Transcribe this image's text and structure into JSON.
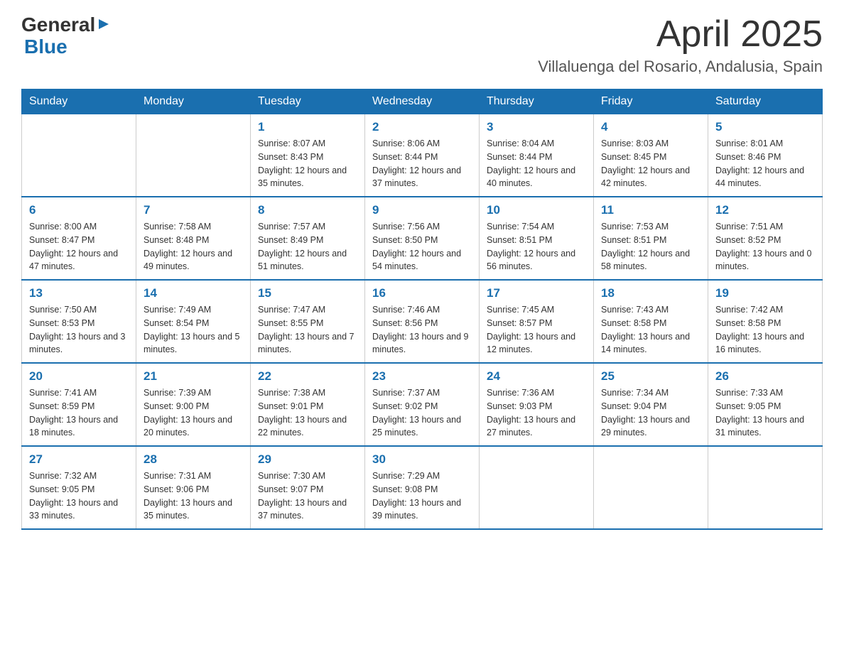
{
  "header": {
    "logo_general": "General",
    "logo_blue": "Blue",
    "month_title": "April 2025",
    "location": "Villaluenga del Rosario, Andalusia, Spain"
  },
  "weekdays": [
    "Sunday",
    "Monday",
    "Tuesday",
    "Wednesday",
    "Thursday",
    "Friday",
    "Saturday"
  ],
  "weeks": [
    [
      {
        "day": "",
        "sunrise": "",
        "sunset": "",
        "daylight": ""
      },
      {
        "day": "",
        "sunrise": "",
        "sunset": "",
        "daylight": ""
      },
      {
        "day": "1",
        "sunrise": "Sunrise: 8:07 AM",
        "sunset": "Sunset: 8:43 PM",
        "daylight": "Daylight: 12 hours and 35 minutes."
      },
      {
        "day": "2",
        "sunrise": "Sunrise: 8:06 AM",
        "sunset": "Sunset: 8:44 PM",
        "daylight": "Daylight: 12 hours and 37 minutes."
      },
      {
        "day": "3",
        "sunrise": "Sunrise: 8:04 AM",
        "sunset": "Sunset: 8:44 PM",
        "daylight": "Daylight: 12 hours and 40 minutes."
      },
      {
        "day": "4",
        "sunrise": "Sunrise: 8:03 AM",
        "sunset": "Sunset: 8:45 PM",
        "daylight": "Daylight: 12 hours and 42 minutes."
      },
      {
        "day": "5",
        "sunrise": "Sunrise: 8:01 AM",
        "sunset": "Sunset: 8:46 PM",
        "daylight": "Daylight: 12 hours and 44 minutes."
      }
    ],
    [
      {
        "day": "6",
        "sunrise": "Sunrise: 8:00 AM",
        "sunset": "Sunset: 8:47 PM",
        "daylight": "Daylight: 12 hours and 47 minutes."
      },
      {
        "day": "7",
        "sunrise": "Sunrise: 7:58 AM",
        "sunset": "Sunset: 8:48 PM",
        "daylight": "Daylight: 12 hours and 49 minutes."
      },
      {
        "day": "8",
        "sunrise": "Sunrise: 7:57 AM",
        "sunset": "Sunset: 8:49 PM",
        "daylight": "Daylight: 12 hours and 51 minutes."
      },
      {
        "day": "9",
        "sunrise": "Sunrise: 7:56 AM",
        "sunset": "Sunset: 8:50 PM",
        "daylight": "Daylight: 12 hours and 54 minutes."
      },
      {
        "day": "10",
        "sunrise": "Sunrise: 7:54 AM",
        "sunset": "Sunset: 8:51 PM",
        "daylight": "Daylight: 12 hours and 56 minutes."
      },
      {
        "day": "11",
        "sunrise": "Sunrise: 7:53 AM",
        "sunset": "Sunset: 8:51 PM",
        "daylight": "Daylight: 12 hours and 58 minutes."
      },
      {
        "day": "12",
        "sunrise": "Sunrise: 7:51 AM",
        "sunset": "Sunset: 8:52 PM",
        "daylight": "Daylight: 13 hours and 0 minutes."
      }
    ],
    [
      {
        "day": "13",
        "sunrise": "Sunrise: 7:50 AM",
        "sunset": "Sunset: 8:53 PM",
        "daylight": "Daylight: 13 hours and 3 minutes."
      },
      {
        "day": "14",
        "sunrise": "Sunrise: 7:49 AM",
        "sunset": "Sunset: 8:54 PM",
        "daylight": "Daylight: 13 hours and 5 minutes."
      },
      {
        "day": "15",
        "sunrise": "Sunrise: 7:47 AM",
        "sunset": "Sunset: 8:55 PM",
        "daylight": "Daylight: 13 hours and 7 minutes."
      },
      {
        "day": "16",
        "sunrise": "Sunrise: 7:46 AM",
        "sunset": "Sunset: 8:56 PM",
        "daylight": "Daylight: 13 hours and 9 minutes."
      },
      {
        "day": "17",
        "sunrise": "Sunrise: 7:45 AM",
        "sunset": "Sunset: 8:57 PM",
        "daylight": "Daylight: 13 hours and 12 minutes."
      },
      {
        "day": "18",
        "sunrise": "Sunrise: 7:43 AM",
        "sunset": "Sunset: 8:58 PM",
        "daylight": "Daylight: 13 hours and 14 minutes."
      },
      {
        "day": "19",
        "sunrise": "Sunrise: 7:42 AM",
        "sunset": "Sunset: 8:58 PM",
        "daylight": "Daylight: 13 hours and 16 minutes."
      }
    ],
    [
      {
        "day": "20",
        "sunrise": "Sunrise: 7:41 AM",
        "sunset": "Sunset: 8:59 PM",
        "daylight": "Daylight: 13 hours and 18 minutes."
      },
      {
        "day": "21",
        "sunrise": "Sunrise: 7:39 AM",
        "sunset": "Sunset: 9:00 PM",
        "daylight": "Daylight: 13 hours and 20 minutes."
      },
      {
        "day": "22",
        "sunrise": "Sunrise: 7:38 AM",
        "sunset": "Sunset: 9:01 PM",
        "daylight": "Daylight: 13 hours and 22 minutes."
      },
      {
        "day": "23",
        "sunrise": "Sunrise: 7:37 AM",
        "sunset": "Sunset: 9:02 PM",
        "daylight": "Daylight: 13 hours and 25 minutes."
      },
      {
        "day": "24",
        "sunrise": "Sunrise: 7:36 AM",
        "sunset": "Sunset: 9:03 PM",
        "daylight": "Daylight: 13 hours and 27 minutes."
      },
      {
        "day": "25",
        "sunrise": "Sunrise: 7:34 AM",
        "sunset": "Sunset: 9:04 PM",
        "daylight": "Daylight: 13 hours and 29 minutes."
      },
      {
        "day": "26",
        "sunrise": "Sunrise: 7:33 AM",
        "sunset": "Sunset: 9:05 PM",
        "daylight": "Daylight: 13 hours and 31 minutes."
      }
    ],
    [
      {
        "day": "27",
        "sunrise": "Sunrise: 7:32 AM",
        "sunset": "Sunset: 9:05 PM",
        "daylight": "Daylight: 13 hours and 33 minutes."
      },
      {
        "day": "28",
        "sunrise": "Sunrise: 7:31 AM",
        "sunset": "Sunset: 9:06 PM",
        "daylight": "Daylight: 13 hours and 35 minutes."
      },
      {
        "day": "29",
        "sunrise": "Sunrise: 7:30 AM",
        "sunset": "Sunset: 9:07 PM",
        "daylight": "Daylight: 13 hours and 37 minutes."
      },
      {
        "day": "30",
        "sunrise": "Sunrise: 7:29 AM",
        "sunset": "Sunset: 9:08 PM",
        "daylight": "Daylight: 13 hours and 39 minutes."
      },
      {
        "day": "",
        "sunrise": "",
        "sunset": "",
        "daylight": ""
      },
      {
        "day": "",
        "sunrise": "",
        "sunset": "",
        "daylight": ""
      },
      {
        "day": "",
        "sunrise": "",
        "sunset": "",
        "daylight": ""
      }
    ]
  ]
}
